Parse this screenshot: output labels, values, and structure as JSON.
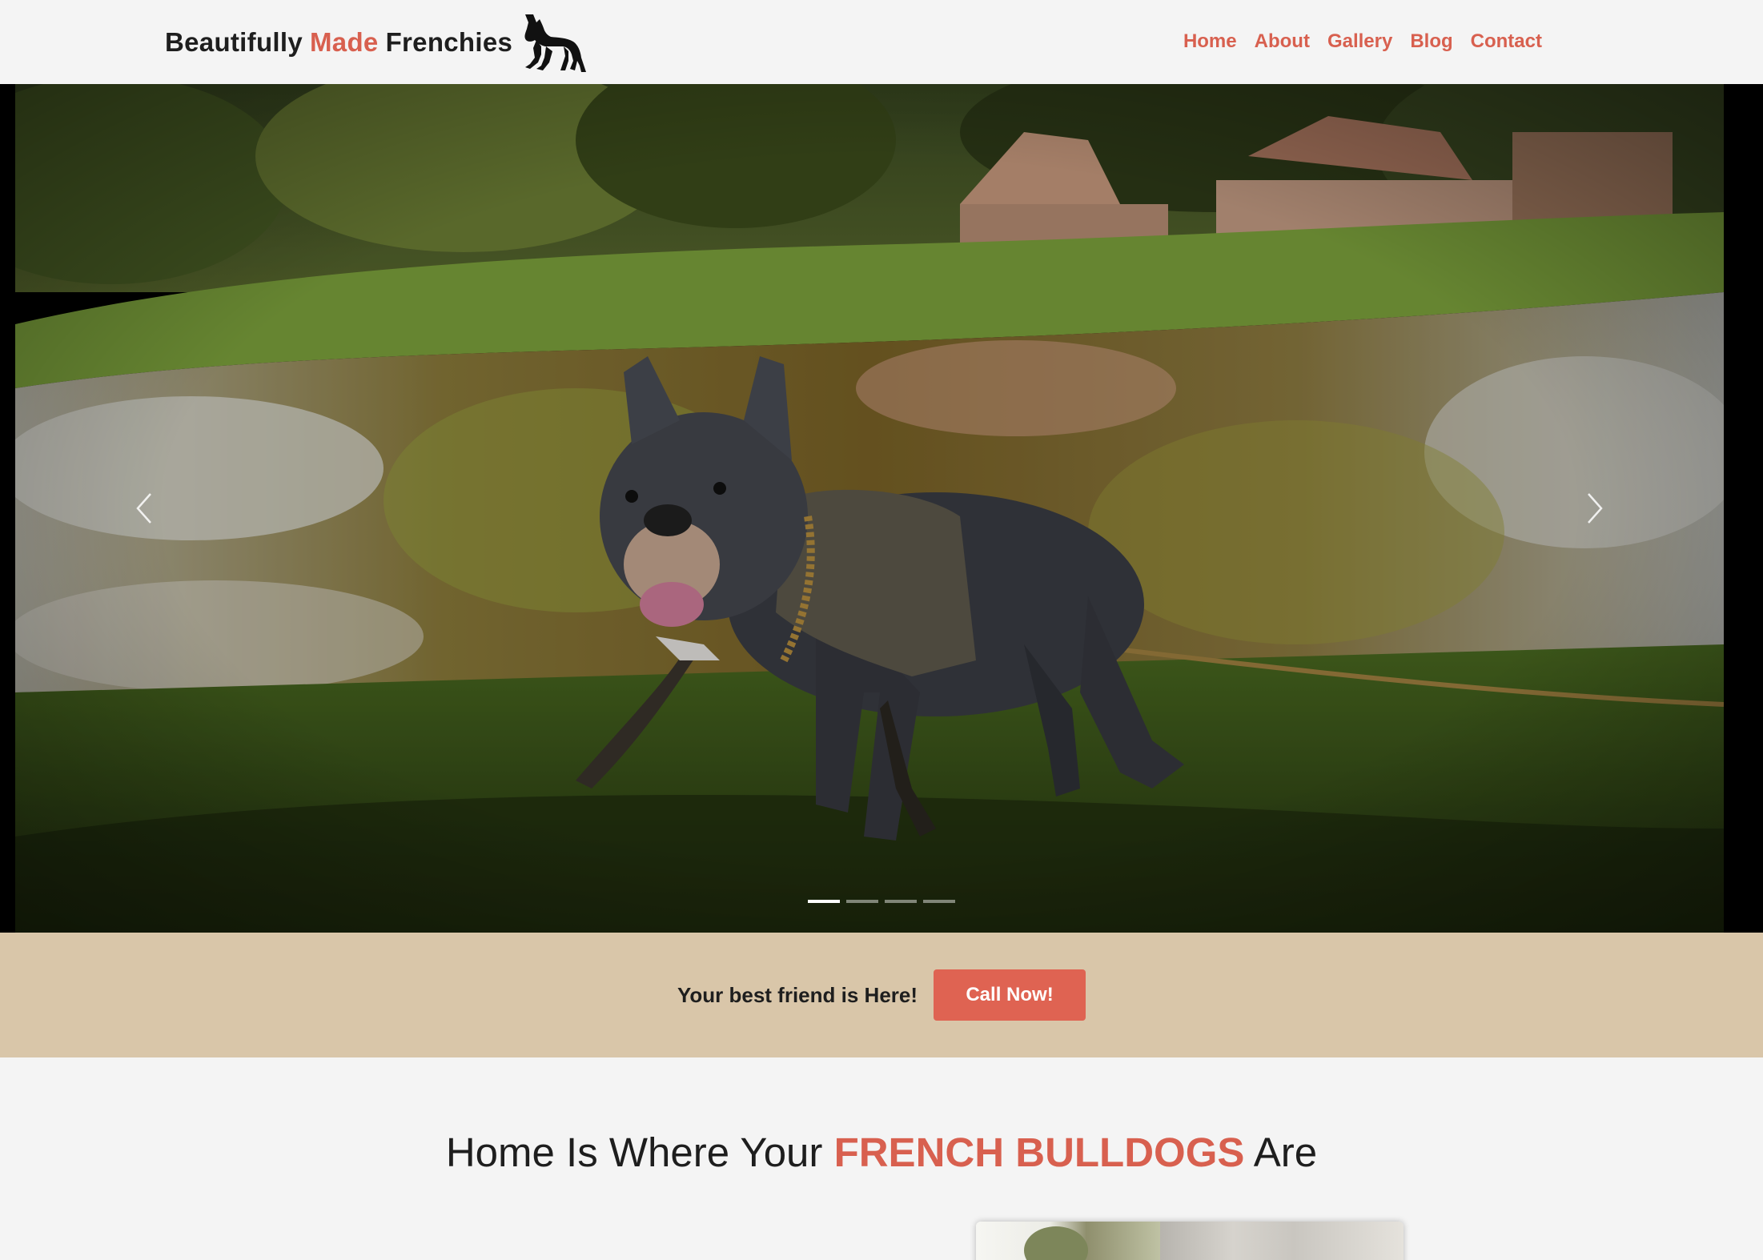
{
  "header": {
    "brand": {
      "part1": "Beautifully",
      "part2": "Made",
      "part3": "Frenchies",
      "logo_icon": "french-bulldog-silhouette"
    },
    "nav": [
      {
        "label": "Home"
      },
      {
        "label": "About"
      },
      {
        "label": "Gallery"
      },
      {
        "label": "Blog"
      },
      {
        "label": "Contact"
      }
    ]
  },
  "carousel": {
    "prev_icon": "chevron-left-icon",
    "next_icon": "chevron-right-icon",
    "slide_count": 4,
    "active_index": 0
  },
  "cta": {
    "text": "Your best friend is Here!",
    "button": "Call Now!"
  },
  "section": {
    "title_part1": "Home Is Where Your",
    "title_accent": "FRENCH BULLDOGS",
    "title_part2": "Are"
  },
  "colors": {
    "accent": "#d8604f",
    "cta_band": "#d9c6a9",
    "button": "#df6352",
    "background": "#f4f4f4"
  }
}
